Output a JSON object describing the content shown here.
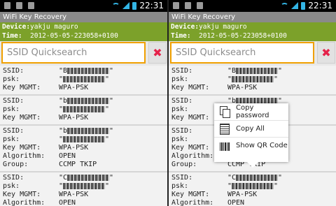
{
  "status_bar": {
    "time": "22:31"
  },
  "app": {
    "title": "WiFi Key Recovery",
    "device_label": "Device:",
    "device_value": "yakju maguro",
    "time_label": "Time:",
    "time_value": "2012-05-05-223058+0100"
  },
  "search": {
    "placeholder": "SSID Quicksearch",
    "clear_icon": "close-icon"
  },
  "labels": {
    "ssid": "SSID:",
    "psk": "psk:",
    "key_mgmt": "Key MGMT:",
    "algorithm": "Algorithm:",
    "group": "Group:"
  },
  "entries": [
    {
      "ssid": "\"B",
      "psk": "\"",
      "key_mgmt": "WPA-PSK"
    },
    {
      "ssid": "\"b",
      "psk": "\"",
      "key_mgmt": "WPA-PSK"
    },
    {
      "ssid": "\"b",
      "psk": "\"",
      "key_mgmt": "WPA-PSK",
      "algorithm": "OPEN",
      "group": "CCMP TKIP"
    },
    {
      "ssid": "\"C",
      "psk": "\"",
      "key_mgmt": "WPA-PSK",
      "algorithm": "OPEN"
    }
  ],
  "context_menu": {
    "items": [
      {
        "label": "Copy password",
        "icon": "copy-icon"
      },
      {
        "label": "Copy All",
        "icon": "copy-all-icon"
      },
      {
        "label": "Show QR Code",
        "icon": "qr-code-icon"
      }
    ]
  },
  "colors": {
    "info_bar": "#7ca12a",
    "search_border": "#f0a000",
    "clear_x": "#e5224a",
    "title_bar": "#8a8a8a"
  }
}
